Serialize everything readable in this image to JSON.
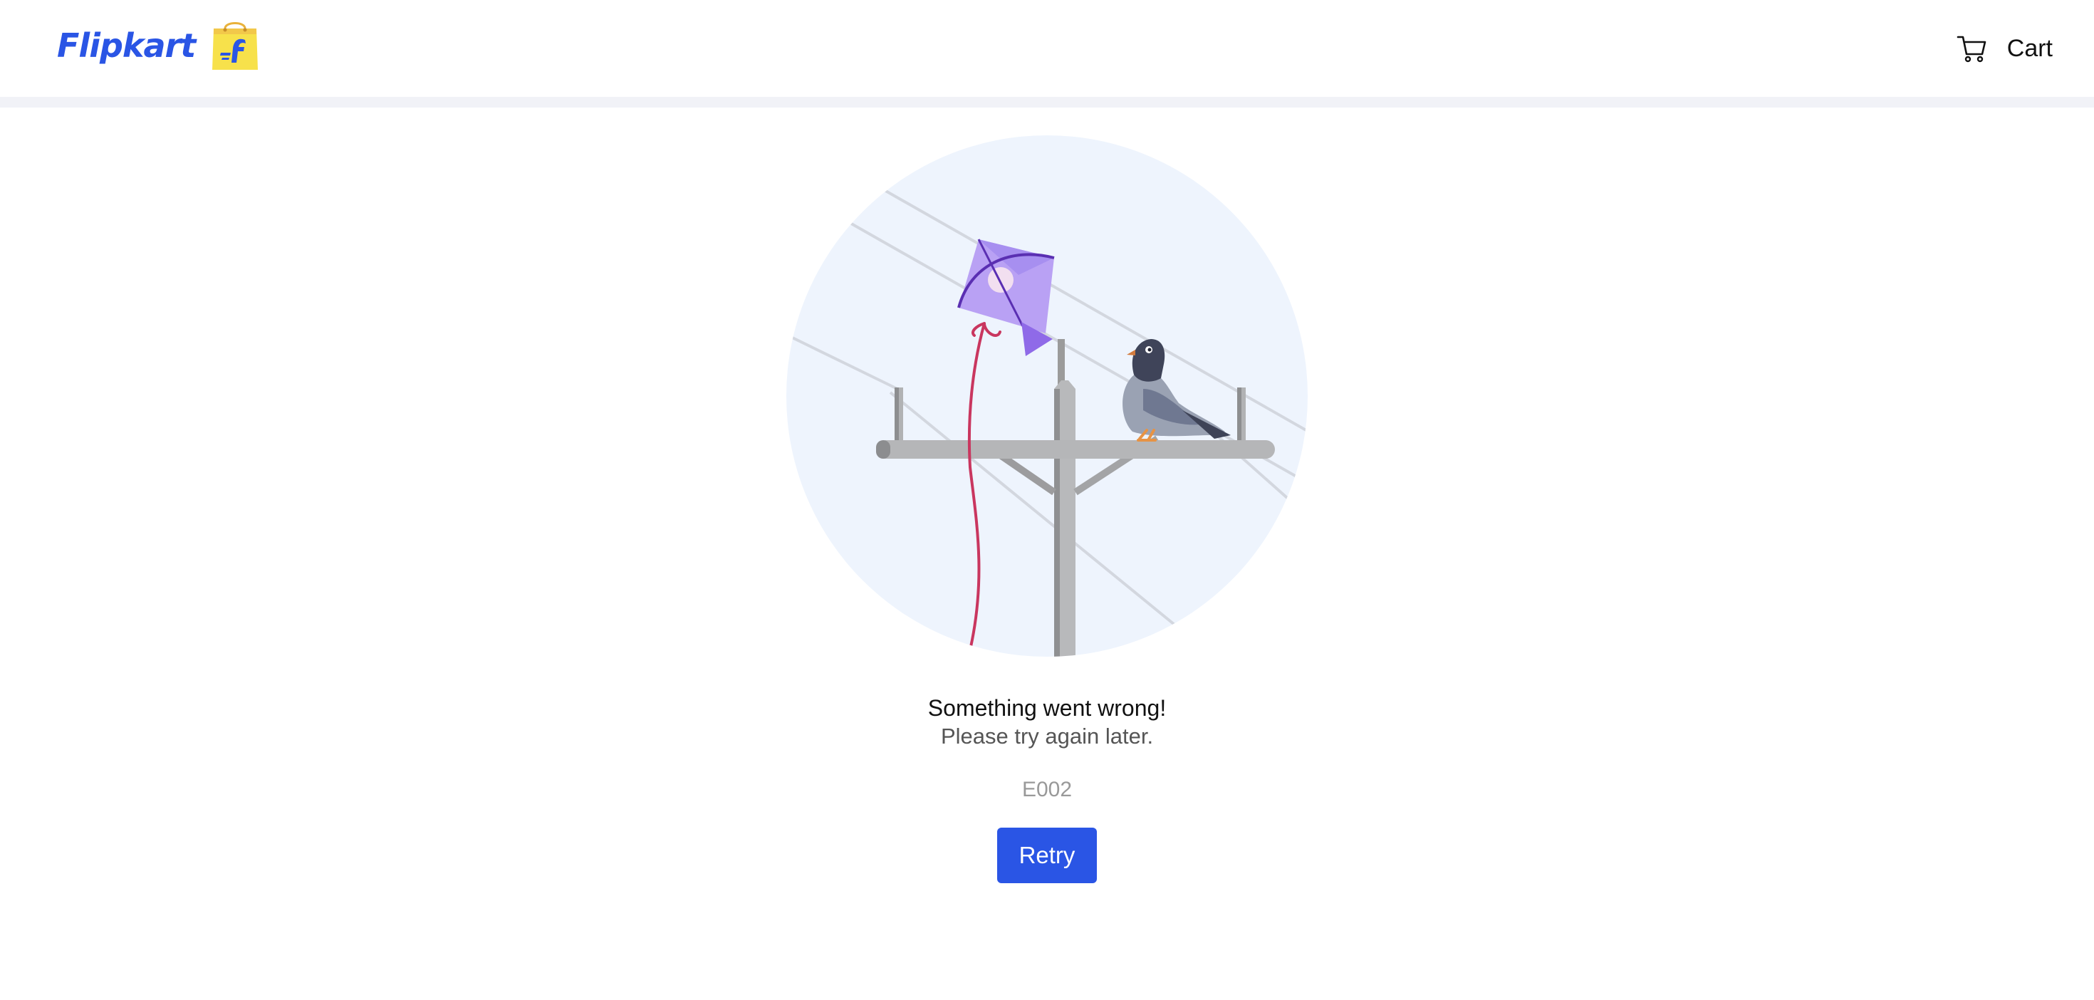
{
  "header": {
    "logo_text": "Flipkart",
    "cart_label": "Cart",
    "brand_color": "#2a55e5",
    "logo_bag_color": "#f7e14b"
  },
  "error": {
    "title": "Something went wrong!",
    "subtitle": "Please try again later.",
    "code": "E002",
    "retry_label": "Retry",
    "retry_color": "#2a55e5"
  },
  "illustration": {
    "name": "kite-stuck-on-utility-pole-with-pigeon"
  }
}
